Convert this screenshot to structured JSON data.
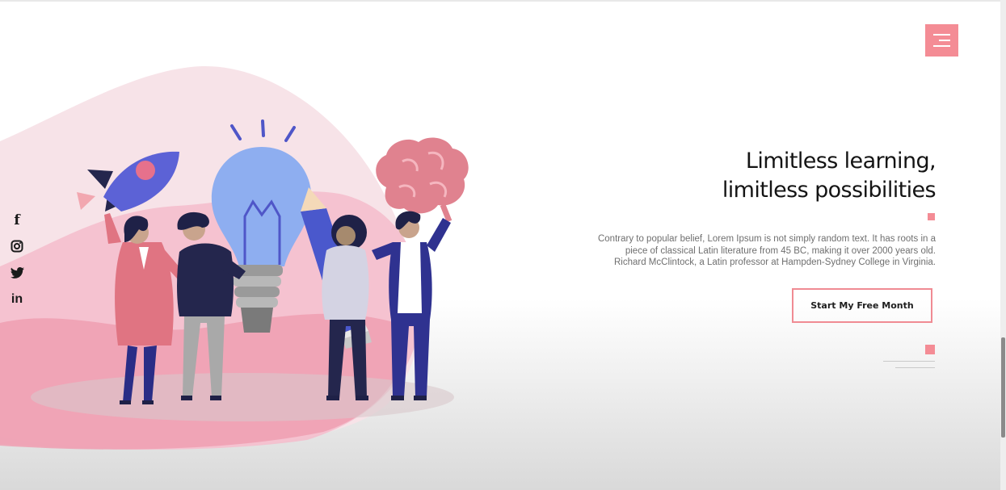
{
  "colors": {
    "accent": "#f48c95",
    "text": "#141414",
    "muted": "#6f6f6f"
  },
  "nav": {
    "menu_icon": "hamburger-menu-icon"
  },
  "social": [
    {
      "name": "facebook-icon",
      "glyph": "f"
    },
    {
      "name": "instagram-icon"
    },
    {
      "name": "twitter-icon"
    },
    {
      "name": "linkedin-icon",
      "glyph": "in"
    }
  ],
  "hero": {
    "title_line1": "Limitless learning,",
    "title_line2": "limitless possibilities",
    "description": "Contrary to popular belief, Lorem Ipsum is not simply random text. It has roots in a piece of classical Latin literature from 45 BC, making it over 2000 years old. Richard McClintock, a Latin professor at Hampden-Sydney College in Virginia.",
    "cta_label": "Start My Free Month"
  }
}
